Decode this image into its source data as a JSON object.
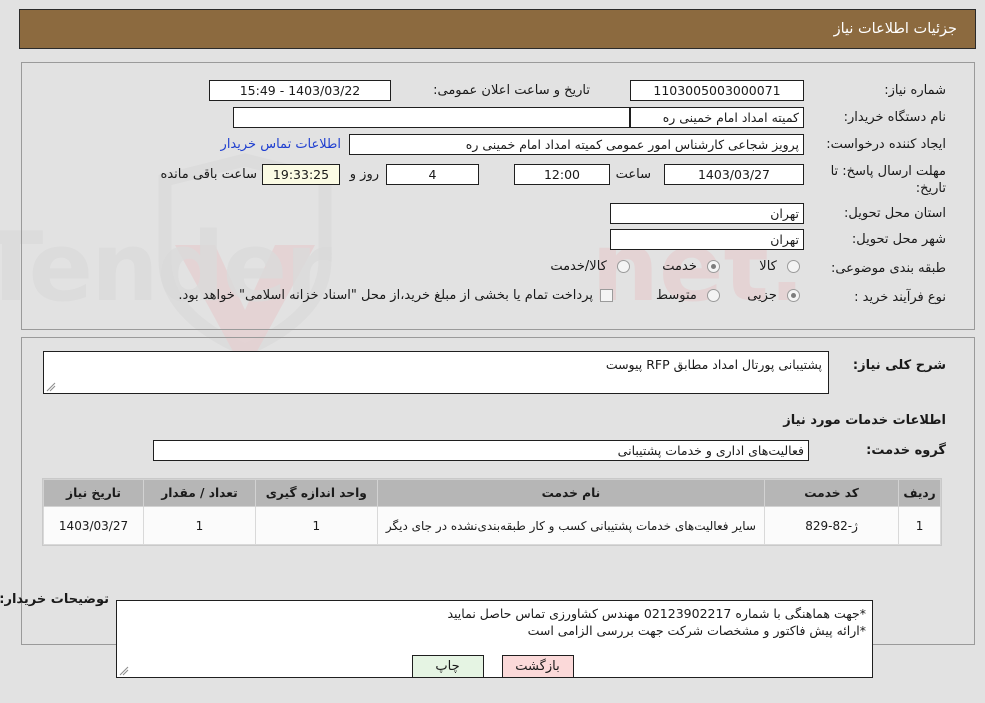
{
  "header": {
    "title": "جزئیات اطلاعات نیاز",
    "bg_color": "#8c6a3f",
    "text_color": "#ffffff"
  },
  "watermark": {
    "text": "AriaTender.net"
  },
  "top_panel": {
    "need_number": {
      "label": "شماره نیاز:",
      "value": "1103005003000071"
    },
    "announce_datetime": {
      "label": "تاریخ و ساعت اعلان عمومی:",
      "value": "1403/03/22 - 15:49"
    },
    "buyer_org": {
      "label": "نام دستگاه خریدار:",
      "value": "کمیته امداد امام خمینی ره"
    },
    "empty_field": {
      "label": "",
      "value": ""
    },
    "request_creator": {
      "label": "ایجاد کننده درخواست:",
      "value": "پرویز شجاعی کارشناس امور عمومی کمیته امداد امام خمینی ره"
    },
    "buyer_contact_link": {
      "label": "اطلاعات تماس خریدار",
      "color": "#1f3fd0"
    },
    "deadline": {
      "label_line1": "مهلت ارسال پاسخ: تا",
      "label_line2": "تاریخ:",
      "date_value": "1403/03/27",
      "time_label": "ساعت",
      "time_value": "12:00",
      "days_value": "4",
      "days_label": "روز و",
      "countdown_value": "19:33:25",
      "countdown_label": "ساعت باقی مانده"
    },
    "delivery_province": {
      "label": "استان محل تحویل:",
      "value": "تهران"
    },
    "delivery_city": {
      "label": "شهر محل تحویل:",
      "value": "تهران"
    },
    "subject_category": {
      "label": "طبقه بندی موضوعی:",
      "options": [
        {
          "label": "کالا",
          "selected": false
        },
        {
          "label": "خدمت",
          "selected": true
        },
        {
          "label": "کالا/خدمت",
          "selected": false
        }
      ]
    },
    "purchase_type": {
      "label": "نوع فرآیند خرید :",
      "options": [
        {
          "label": "جزیی",
          "selected": true
        },
        {
          "label": "متوسط",
          "selected": false
        }
      ],
      "checkbox": {
        "label": "پرداخت تمام یا بخشی از مبلغ خرید،از محل \"اسناد خزانه اسلامی\" خواهد بود.",
        "checked": false
      }
    }
  },
  "bottom_panel": {
    "general_description": {
      "label": "شرح کلی نیاز:",
      "value": "پشتیبانی پورتال امداد مطابق RFP پیوست"
    },
    "services_section_title": "اطلاعات خدمات مورد نیاز",
    "service_group": {
      "label": "گروه خدمت:",
      "value": "فعالیت‌های اداری و خدمات پشتیبانی"
    },
    "items_table": {
      "columns": [
        "ردیف",
        "کد خدمت",
        "نام خدمت",
        "واحد اندازه گیری",
        "تعداد / مقدار",
        "تاریخ نیاز"
      ],
      "rows": [
        {
          "row_no": "1",
          "service_code": "ژ-82-829",
          "service_name": "سایر فعالیت‌های خدمات پشتیبانی کسب و کار طبقه‌بندی‌نشده در جای دیگر",
          "unit": "1",
          "quantity": "1",
          "need_date": "1403/03/27"
        }
      ]
    },
    "buyer_notes": {
      "label": "توضیحات خریدار:",
      "lines": [
        "*جهت هماهنگی با شماره 02123902217 مهندس کشاورزی تماس حاصل نمایید",
        "*ارائه پیش فاکتور و مشخصات شرکت جهت بررسی الزامی است"
      ]
    }
  },
  "footer": {
    "buttons": [
      {
        "name": "print",
        "label": "چاپ",
        "bg": "#e5f4e3"
      },
      {
        "name": "back",
        "label": "بازگشت",
        "bg": "#fbd9d9"
      }
    ]
  }
}
